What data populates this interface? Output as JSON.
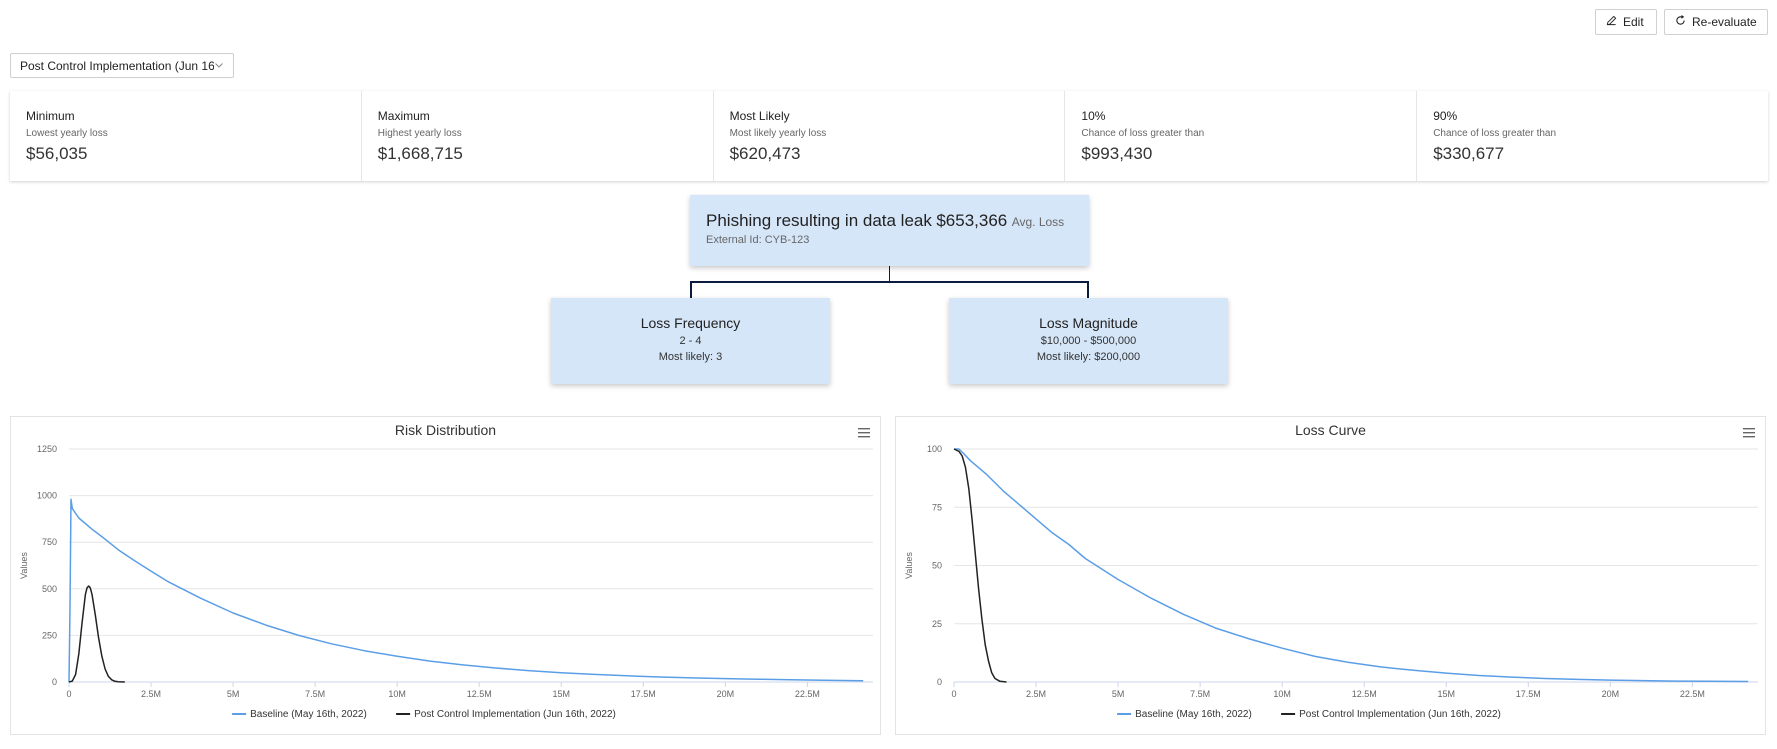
{
  "toolbar": {
    "edit_label": "Edit",
    "reevaluate_label": "Re-evaluate"
  },
  "scenario_select": {
    "value": "Post Control Implementation (Jun 16..."
  },
  "stats": [
    {
      "title": "Minimum",
      "subtitle": "Lowest yearly loss",
      "value": "$56,035"
    },
    {
      "title": "Maximum",
      "subtitle": "Highest yearly loss",
      "value": "$1,668,715"
    },
    {
      "title": "Most Likely",
      "subtitle": "Most likely yearly loss",
      "value": "$620,473"
    },
    {
      "title": "10%",
      "subtitle": "Chance of loss greater than",
      "value": "$993,430"
    },
    {
      "title": "90%",
      "subtitle": "Chance of loss greater than",
      "value": "$330,677"
    }
  ],
  "tree": {
    "root": {
      "title": "Phishing resulting in data leak",
      "amount": "$653,366",
      "amount_suffix": "Avg. Loss",
      "external_id": "External Id: CYB-123"
    },
    "frequency": {
      "title": "Loss Frequency",
      "range": "2 - 4",
      "most_likely": "Most likely: 3"
    },
    "magnitude": {
      "title": "Loss Magnitude",
      "range": "$10,000 - $500,000",
      "most_likely": "Most likely: $200,000"
    }
  },
  "colors": {
    "baseline": "#5b9ee6",
    "post_control": "#222222",
    "node_bg": "#d6e6f9",
    "connector": "#0b1b3d"
  },
  "chart_data": [
    {
      "type": "line",
      "title": "Risk Distribution",
      "xlabel": "",
      "ylabel": "Values",
      "xlim": [
        0,
        24500000
      ],
      "ylim": [
        0,
        1250
      ],
      "x_ticks": [
        "0",
        "2.5M",
        "5M",
        "7.5M",
        "10M",
        "12.5M",
        "15M",
        "17.5M",
        "20M",
        "22.5M"
      ],
      "x_tick_values": [
        0,
        2500000,
        5000000,
        7500000,
        10000000,
        12500000,
        15000000,
        17500000,
        20000000,
        22500000
      ],
      "y_ticks": [
        "0",
        "250",
        "500",
        "750",
        "1000",
        "1250"
      ],
      "y_tick_values": [
        0,
        250,
        500,
        750,
        1000,
        1250
      ],
      "grid": true,
      "legend": "bottom",
      "series": [
        {
          "name": "Baseline (May 16th, 2022)",
          "x": [
            0,
            30000,
            60000,
            100000,
            300000,
            700000,
            1000000,
            1500000,
            2000000,
            2500000,
            3000000,
            4000000,
            5000000,
            6000000,
            7000000,
            8000000,
            9000000,
            10000000,
            11000000,
            12000000,
            13000000,
            14000000,
            15000000,
            16000000,
            17000000,
            18000000,
            19000000,
            20000000,
            21000000,
            22000000,
            23000000,
            24200000
          ],
          "y": [
            0,
            400,
            980,
            930,
            880,
            820,
            780,
            710,
            650,
            595,
            540,
            450,
            370,
            305,
            250,
            205,
            168,
            138,
            112,
            92,
            75,
            61,
            50,
            41,
            33,
            27,
            22,
            18,
            15,
            12,
            9,
            7
          ]
        },
        {
          "name": "Post Control Implementation (Jun 16th, 2022)",
          "x": [
            0,
            100000,
            200000,
            300000,
            400000,
            500000,
            550000,
            600000,
            650000,
            700000,
            800000,
            900000,
            1000000,
            1100000,
            1200000,
            1300000,
            1400000,
            1500000,
            1700000
          ],
          "y": [
            0,
            5,
            40,
            150,
            320,
            470,
            505,
            515,
            505,
            470,
            360,
            240,
            140,
            70,
            30,
            12,
            4,
            1,
            0
          ]
        }
      ]
    },
    {
      "type": "line",
      "title": "Loss Curve",
      "xlabel": "",
      "ylabel": "Values",
      "xlim": [
        0,
        24500000
      ],
      "ylim": [
        0,
        100
      ],
      "x_ticks": [
        "0",
        "2.5M",
        "5M",
        "7.5M",
        "10M",
        "12.5M",
        "15M",
        "17.5M",
        "20M",
        "22.5M"
      ],
      "x_tick_values": [
        0,
        2500000,
        5000000,
        7500000,
        10000000,
        12500000,
        15000000,
        17500000,
        20000000,
        22500000
      ],
      "y_ticks": [
        "0",
        "25",
        "50",
        "75",
        "100"
      ],
      "y_tick_values": [
        0,
        25,
        50,
        75,
        100
      ],
      "grid": true,
      "legend": "bottom",
      "series": [
        {
          "name": "Baseline (May 16th, 2022)",
          "x": [
            0,
            150000,
            300000,
            500000,
            1000000,
            1500000,
            2000000,
            2500000,
            3000000,
            3500000,
            4000000,
            5000000,
            6000000,
            7000000,
            8000000,
            9000000,
            10000000,
            11000000,
            12000000,
            13000000,
            14000000,
            15000000,
            16000000,
            17000000,
            18000000,
            19000000,
            20000000,
            21000000,
            22000000,
            23000000,
            24200000
          ],
          "y": [
            100,
            100,
            98,
            95,
            89,
            82,
            76,
            70,
            64,
            59,
            53,
            44,
            36,
            29,
            23,
            18.5,
            14.5,
            11,
            8.5,
            6.5,
            5,
            3.8,
            2.8,
            2.1,
            1.5,
            1.1,
            0.8,
            0.6,
            0.4,
            0.3,
            0.2
          ]
        },
        {
          "name": "Post Control Implementation (Jun 16th, 2022)",
          "x": [
            0,
            150000,
            250000,
            350000,
            450000,
            550000,
            650000,
            750000,
            850000,
            950000,
            1050000,
            1150000,
            1250000,
            1400000,
            1600000
          ],
          "y": [
            100,
            99,
            97,
            92,
            83,
            70,
            55,
            40,
            27,
            16,
            9,
            4,
            1.5,
            0.3,
            0
          ]
        }
      ]
    }
  ]
}
